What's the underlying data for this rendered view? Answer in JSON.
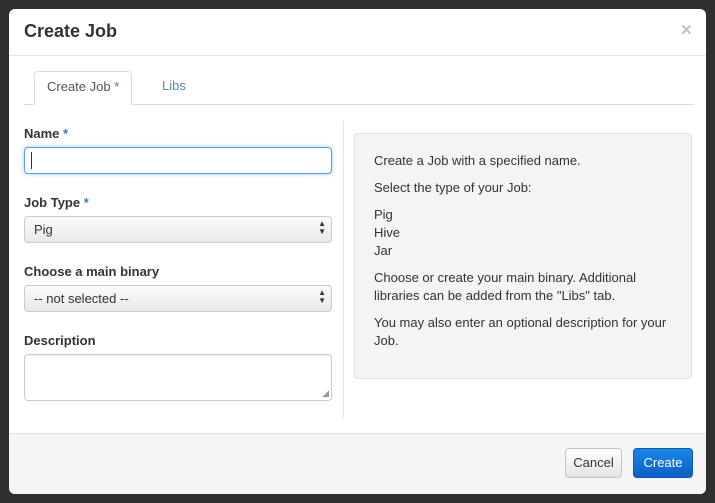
{
  "dialog": {
    "title": "Create Job",
    "close_glyph": "×"
  },
  "tabs": [
    {
      "label": "Create Job",
      "required_marker": "*",
      "active": true
    },
    {
      "label": "Libs",
      "active": false
    }
  ],
  "form": {
    "name": {
      "label": "Name",
      "required_marker": "*",
      "value": ""
    },
    "job_type": {
      "label": "Job Type",
      "required_marker": "*",
      "selected": "Pig"
    },
    "main_binary": {
      "label": "Choose a main binary",
      "selected": "-- not selected --"
    },
    "description": {
      "label": "Description",
      "value": ""
    }
  },
  "help": {
    "lines": [
      "Create a Job with a specified name.",
      "Select the type of your Job:",
      "Pig",
      "Hive",
      "Jar",
      "Choose or create your main binary. Additional",
      "libraries can be added from the \"Libs\" tab.",
      "You may also enter an optional description for your",
      "Job."
    ]
  },
  "footer": {
    "cancel_label": "Cancel",
    "create_label": "Create"
  },
  "colors": {
    "accent": "#0a5fc6",
    "link": "#5d8ab3",
    "required": "#3a77c3",
    "focus_border": "#5b9dd9"
  }
}
